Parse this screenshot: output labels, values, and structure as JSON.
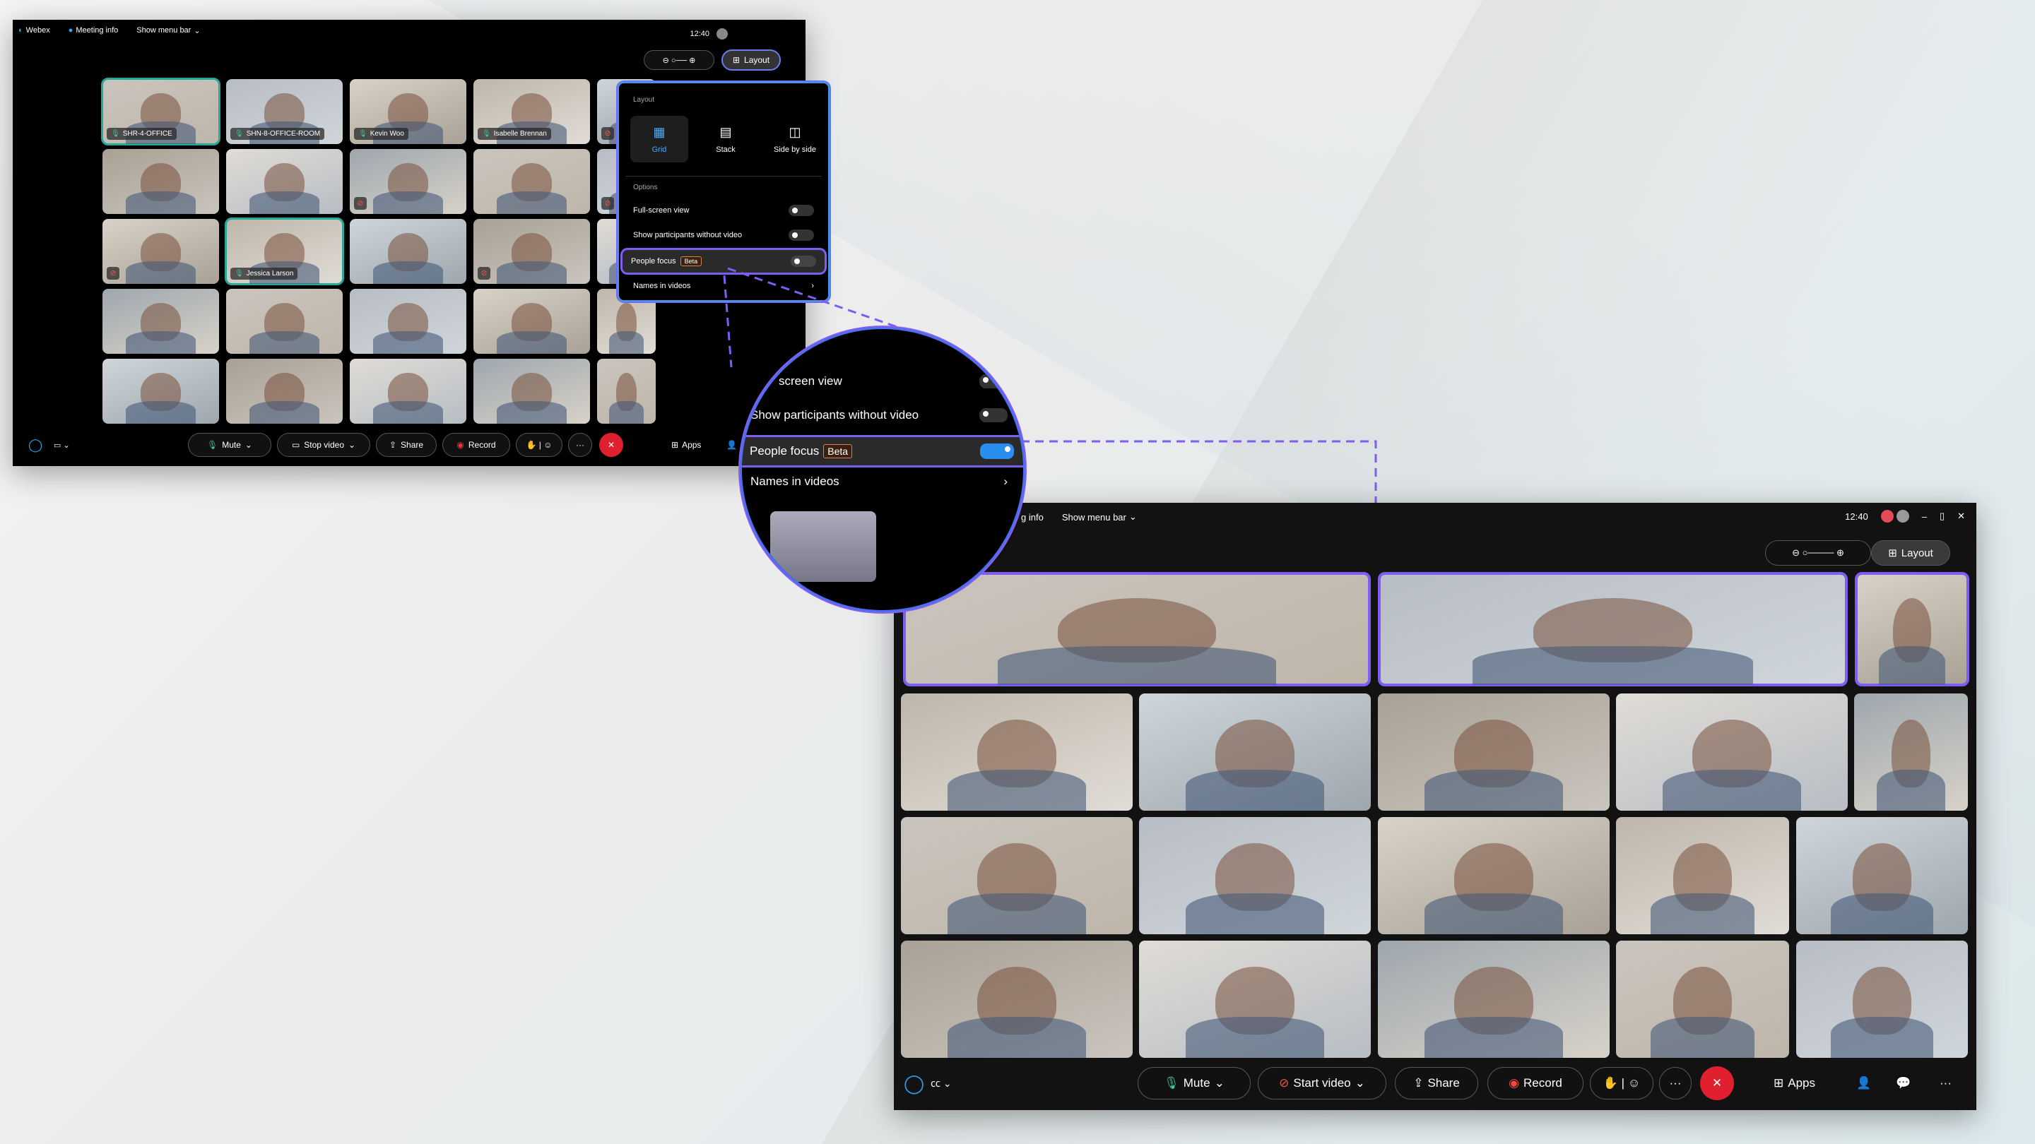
{
  "window_small": {
    "app": "Webex",
    "meeting_info": "Meeting info",
    "show_menu_bar": "Show menu bar",
    "time": "12:40",
    "layout_button": "Layout",
    "tiles": [
      {
        "label": "SHR-4-OFFICE",
        "selected": true
      },
      {
        "label": "SHN-8-OFFICE-ROOM"
      },
      {
        "label": "Kevin Woo"
      },
      {
        "label": "Isabelle Brennan"
      },
      {
        "muted": true
      },
      {},
      {},
      {
        "muted": true
      },
      {},
      {
        "muted": true
      },
      {
        "muted": true
      },
      {
        "label": "Jessica Larson",
        "selected": true
      },
      {},
      {
        "muted": true
      },
      {},
      {},
      {},
      {},
      {},
      {},
      {},
      {},
      {},
      {},
      {}
    ],
    "toolbar": {
      "mute": "Mute",
      "stop_video": "Stop video",
      "share": "Share",
      "record": "Record",
      "apps": "Apps"
    }
  },
  "layout_panel": {
    "heading": "Layout",
    "layouts": [
      {
        "label": "Grid",
        "active": true
      },
      {
        "label": "Stack"
      },
      {
        "label": "Side by side"
      }
    ],
    "options_heading": "Options",
    "options": [
      {
        "label": "Full-screen view",
        "on": false
      },
      {
        "label": "Show participants without video",
        "on": false
      },
      {
        "label": "People focus",
        "badge": "Beta",
        "on": false,
        "highlighted": true
      }
    ],
    "names_in_videos": "Names in videos"
  },
  "magnifier": {
    "options": [
      {
        "label": "screen view",
        "on": false
      },
      {
        "label": "Show participants without video",
        "on": false
      },
      {
        "label": "People focus",
        "badge": "Beta",
        "on": true
      }
    ],
    "names_in_videos": "Names in videos"
  },
  "window_large": {
    "meeting_info": "g info",
    "show_menu_bar": "Show menu bar",
    "time": "12:40",
    "layout_button": "Layout",
    "toolbar": {
      "mute": "Mute",
      "start_video": "Start video",
      "share": "Share",
      "record": "Record",
      "apps": "Apps"
    }
  },
  "colors": {
    "accent": "#2a8df0",
    "focus": "#7f5df0",
    "end_call": "#e0202e",
    "selected": "#27a99a",
    "beta": "#d6834a"
  }
}
